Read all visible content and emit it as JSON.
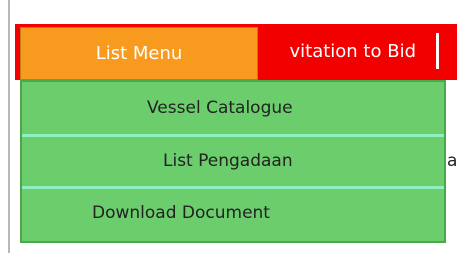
{
  "navbar": {
    "background_color": "#f20000",
    "tab_label_partial": "vitation to Bid"
  },
  "list_menu": {
    "label": "List Menu",
    "color": "#f79a1e"
  },
  "dropdown": {
    "color": "#6ccd6c",
    "items": [
      {
        "label": "Vessel Catalogue"
      },
      {
        "label": "List Pengadaan"
      },
      {
        "label": "Download Document"
      }
    ]
  },
  "background_text_partial": "a"
}
